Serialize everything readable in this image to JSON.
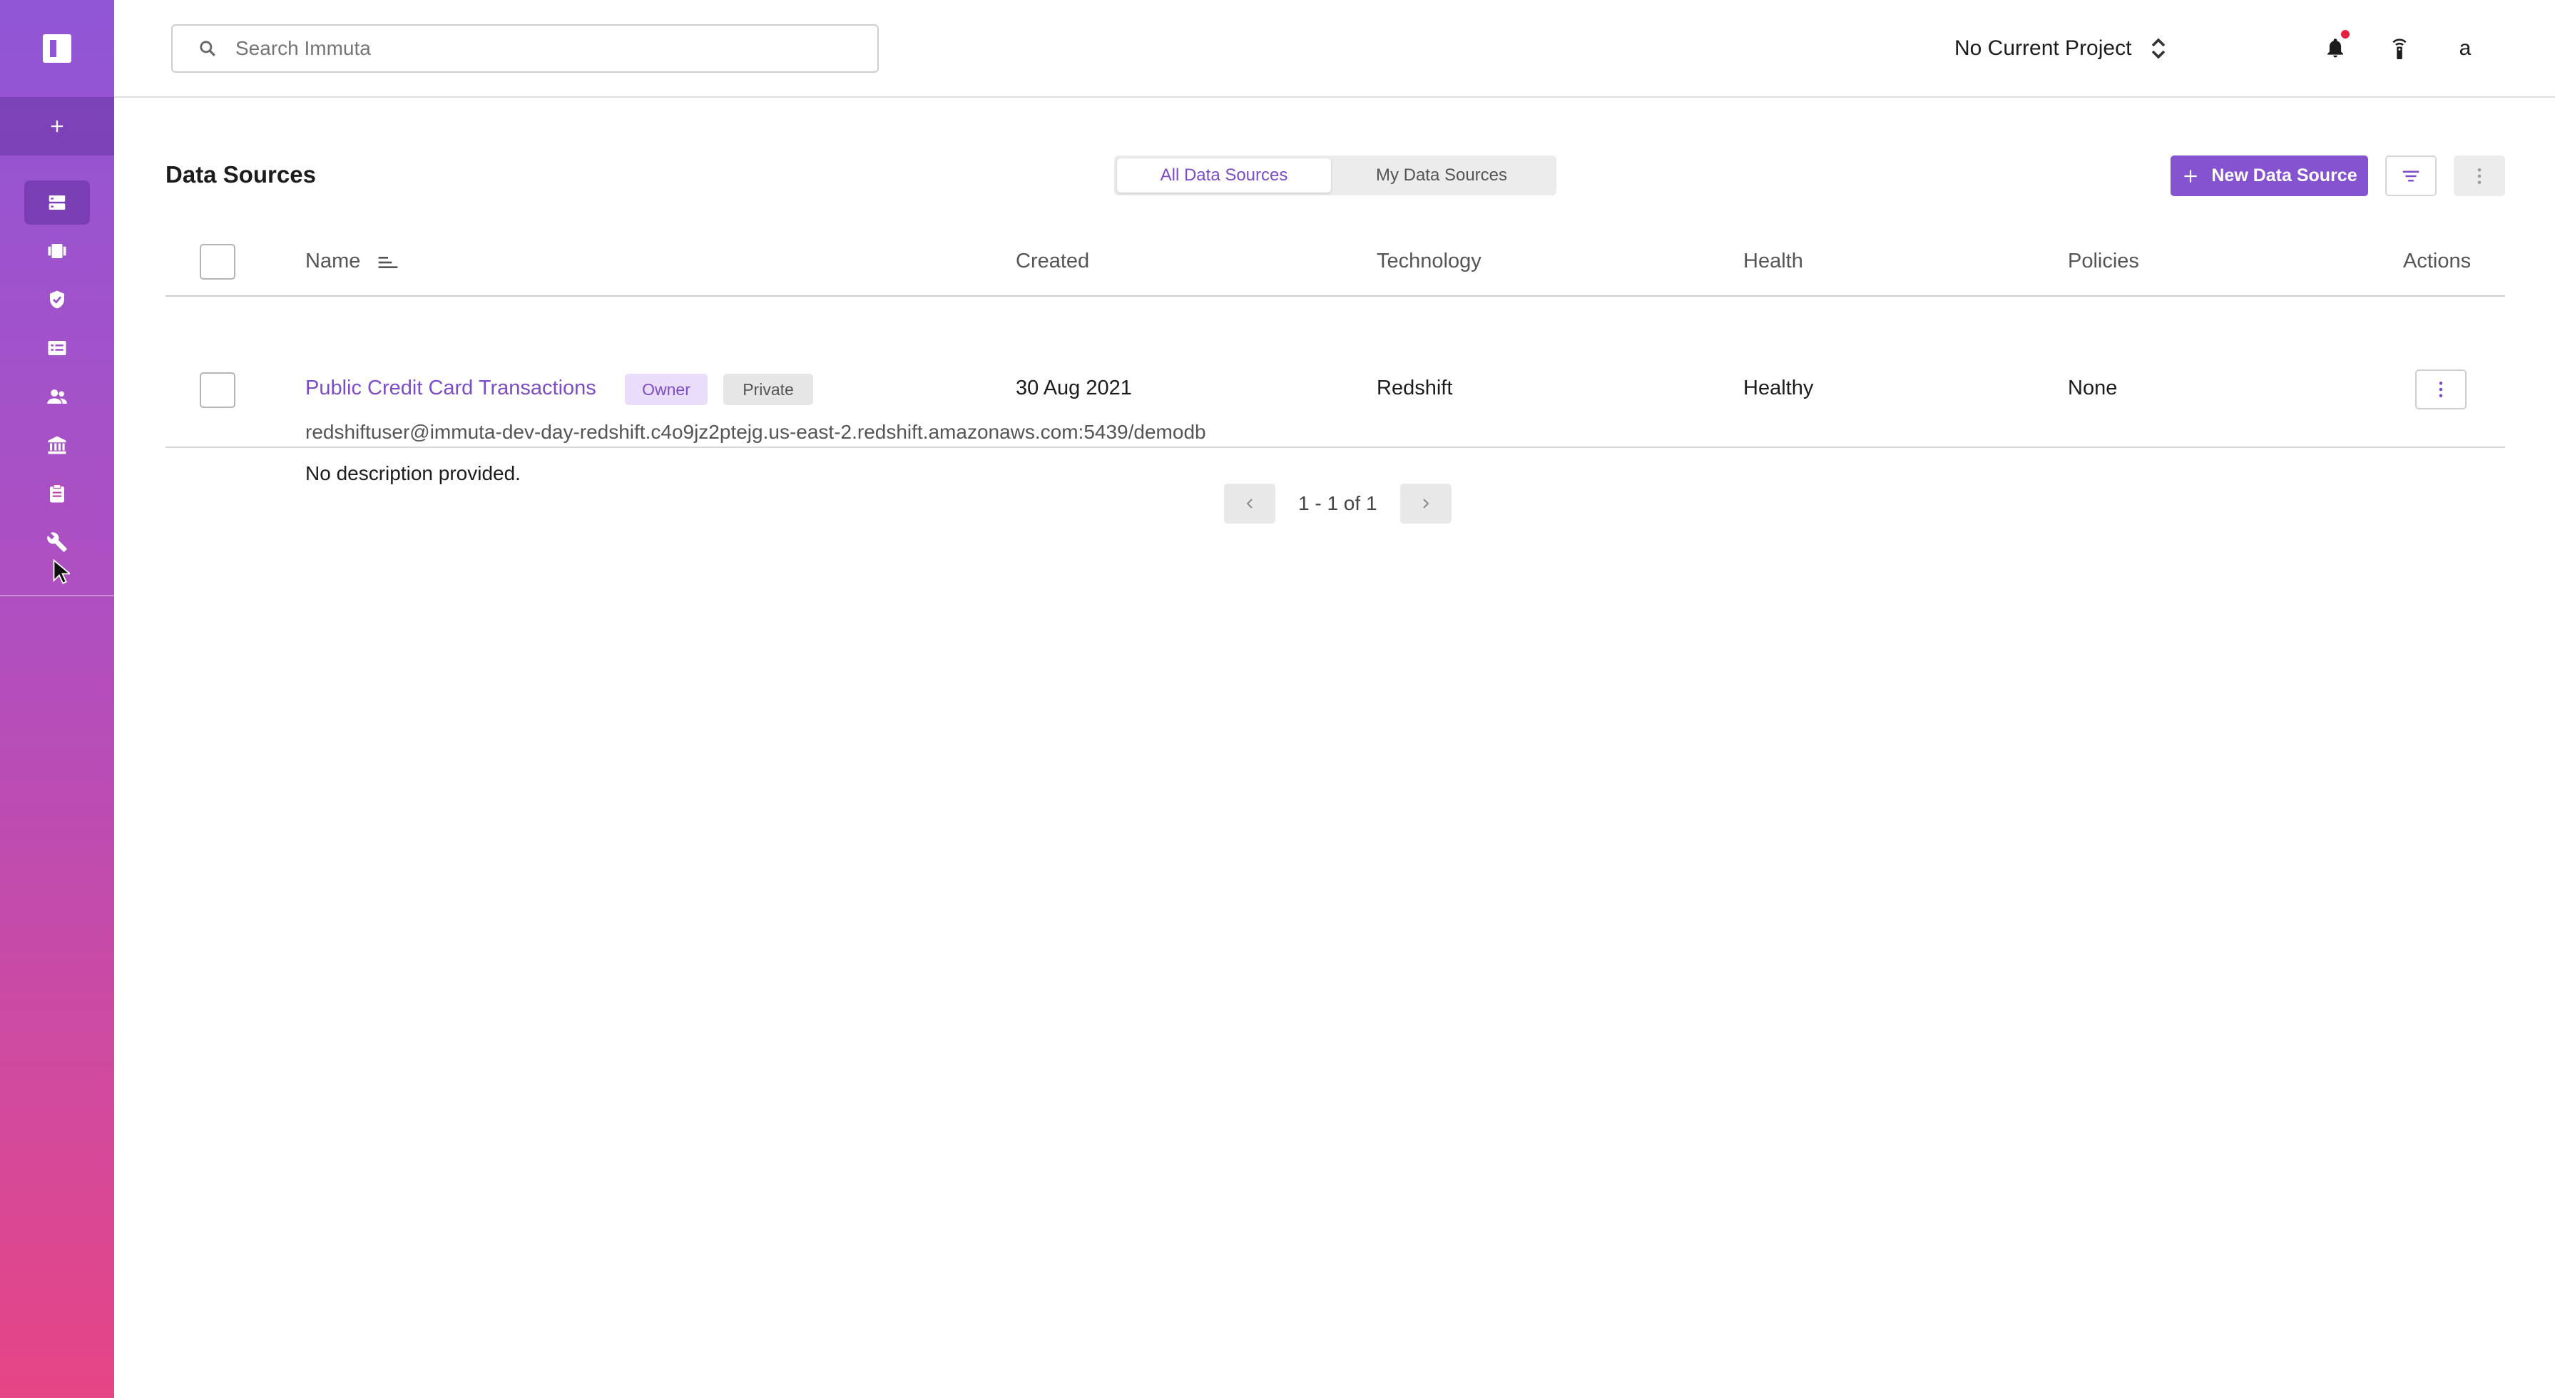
{
  "sidebar": {
    "items": [
      {
        "icon": "data-sources-icon",
        "active": true
      },
      {
        "icon": "projects-icon",
        "active": false
      },
      {
        "icon": "policies-icon",
        "active": false
      },
      {
        "icon": "governance-icon",
        "active": false
      },
      {
        "icon": "people-icon",
        "active": false
      },
      {
        "icon": "institution-icon",
        "active": false
      },
      {
        "icon": "audit-icon",
        "active": false
      },
      {
        "icon": "app-settings-icon",
        "active": false
      }
    ]
  },
  "header": {
    "search_placeholder": "Search Immuta",
    "project_label": "No Current Project",
    "user_initial": "a",
    "notification_dot_color": "#e0223e"
  },
  "page": {
    "title": "Data Sources",
    "tabs": [
      {
        "label": "All Data Sources",
        "active": true
      },
      {
        "label": "My Data Sources",
        "active": false
      }
    ],
    "new_button_label": "New Data Source",
    "accent_color": "#8553d0"
  },
  "table": {
    "columns": {
      "name": "Name",
      "created": "Created",
      "technology": "Technology",
      "health": "Health",
      "policies": "Policies",
      "actions": "Actions"
    },
    "rows": [
      {
        "name": "Public Credit Card Transactions",
        "badges": [
          "Owner",
          "Private"
        ],
        "created": "30 Aug 2021",
        "technology": "Redshift",
        "health": "Healthy",
        "policies": "None",
        "connection": "redshiftuser@immuta-dev-day-redshift.c4o9jz2ptejg.us-east-2.redshift.amazonaws.com:5439/demodb",
        "description": "No description provided."
      }
    ]
  },
  "pagination": {
    "text": "1 - 1 of 1"
  }
}
